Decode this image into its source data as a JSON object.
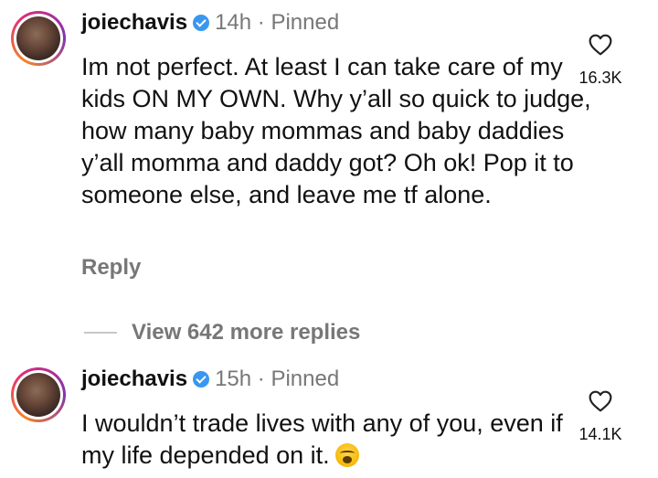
{
  "comments": [
    {
      "username": "joiechavis",
      "time": "14h",
      "separator": "·",
      "pinned_label": "Pinned",
      "text": "Im not perfect. At least I can take care of my kids ON MY OWN. Why y’all so quick to judge, how many baby mommas and baby daddies y’all momma and daddy got? Oh ok! Pop it to someone else, and leave me tf alone.",
      "reply_label": "Reply",
      "likes": "16.3K"
    },
    {
      "username": "joiechavis",
      "time": "15h",
      "separator": "·",
      "pinned_label": "Pinned",
      "text": "I wouldn’t trade lives with any of you, even if my life depended on it.",
      "emoji": "weary-face",
      "likes": "14.1K"
    }
  ],
  "view_more_replies": "View 642 more replies",
  "colors": {
    "verified": "#3897f0",
    "muted": "#777777",
    "text": "#111111"
  }
}
